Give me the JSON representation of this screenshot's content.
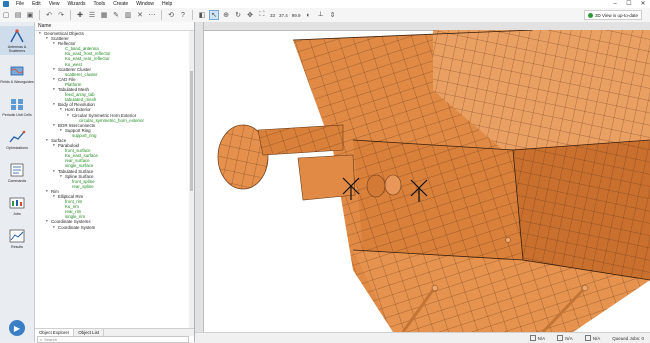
{
  "menubar": {
    "items": [
      "File",
      "Edit",
      "View",
      "Wizards",
      "Tools",
      "Create",
      "Window",
      "Help"
    ]
  },
  "toolbar": {
    "zoom_a": "33",
    "zoom_b": "37.4",
    "zoom_c": "99.9",
    "status_text": "3D View is up-to-date",
    "status_color": "#2e9b3a"
  },
  "sidebar": {
    "items": [
      {
        "label": "Antennas & Scatterers",
        "icon": "antenna-icon"
      },
      {
        "label": "Fields & Waveguides",
        "icon": "waveguide-icon"
      },
      {
        "label": "Periodic Unit Cells",
        "icon": "unit-cell-icon"
      },
      {
        "label": "Optimizations",
        "icon": "optimization-icon"
      },
      {
        "label": "Commands",
        "icon": "commands-icon"
      },
      {
        "label": "Jobs",
        "icon": "jobs-icon"
      },
      {
        "label": "Results",
        "icon": "results-icon"
      }
    ]
  },
  "tree": {
    "header": "Name",
    "search_placeholder": "Search",
    "rows": [
      {
        "label": "Geometrical Objects",
        "level": 0,
        "exp": "▾",
        "green": false
      },
      {
        "label": "Scatterer",
        "level": 1,
        "exp": "▾",
        "green": false
      },
      {
        "label": "Reflector",
        "level": 2,
        "exp": "▾",
        "green": false
      },
      {
        "label": "C_band_antenna",
        "level": 3,
        "exp": "",
        "green": true
      },
      {
        "label": "Ku_east_front_reflector",
        "level": 3,
        "exp": "",
        "green": true
      },
      {
        "label": "Ku_east_rear_reflector",
        "level": 3,
        "exp": "",
        "green": true
      },
      {
        "label": "Ku_west",
        "level": 3,
        "exp": "",
        "green": true
      },
      {
        "label": "Scatterer Cluster",
        "level": 2,
        "exp": "▾",
        "green": false
      },
      {
        "label": "scatterer_cluster",
        "level": 3,
        "exp": "",
        "green": true
      },
      {
        "label": "CAD File",
        "level": 2,
        "exp": "▾",
        "green": false
      },
      {
        "label": "Platform",
        "level": 3,
        "exp": "",
        "green": true
      },
      {
        "label": "Tabulated Mesh",
        "level": 2,
        "exp": "▾",
        "green": false
      },
      {
        "label": "feed_array_tab",
        "level": 3,
        "exp": "",
        "green": true
      },
      {
        "label": "tabulated_mesh",
        "level": 3,
        "exp": "",
        "green": true
      },
      {
        "label": "Body of Revolution",
        "level": 2,
        "exp": "▾",
        "green": false
      },
      {
        "label": "Horn Exterior",
        "level": 3,
        "exp": "▾",
        "green": false
      },
      {
        "label": "Circular Symmetric Horn Exterior",
        "level": 4,
        "exp": "▾",
        "green": false
      },
      {
        "label": "circular_symmetric_horn_exterior",
        "level": 5,
        "exp": "",
        "green": true
      },
      {
        "label": "BOR Interconnects",
        "level": 2,
        "exp": "▾",
        "green": false
      },
      {
        "label": "Support Ring",
        "level": 3,
        "exp": "▾",
        "green": false
      },
      {
        "label": "support_ring",
        "level": 4,
        "exp": "",
        "green": true
      },
      {
        "label": "Surface",
        "level": 1,
        "exp": "▾",
        "green": false
      },
      {
        "label": "Paraboloid",
        "level": 2,
        "exp": "▾",
        "green": false
      },
      {
        "label": "front_surface",
        "level": 3,
        "exp": "",
        "green": true
      },
      {
        "label": "Ku_east_surface",
        "level": 3,
        "exp": "",
        "green": true
      },
      {
        "label": "rear_surface",
        "level": 3,
        "exp": "",
        "green": true
      },
      {
        "label": "single_surface",
        "level": 3,
        "exp": "",
        "green": true
      },
      {
        "label": "Tabulated Surface",
        "level": 2,
        "exp": "▾",
        "green": false
      },
      {
        "label": "Spline Surface",
        "level": 3,
        "exp": "▾",
        "green": false
      },
      {
        "label": "front_spline",
        "level": 4,
        "exp": "",
        "green": true
      },
      {
        "label": "rear_spline",
        "level": 4,
        "exp": "",
        "green": true
      },
      {
        "label": "Rim",
        "level": 1,
        "exp": "▾",
        "green": false
      },
      {
        "label": "Elliptical Rim",
        "level": 2,
        "exp": "▾",
        "green": false
      },
      {
        "label": "front_rim",
        "level": 3,
        "exp": "",
        "green": true
      },
      {
        "label": "Ku_rim",
        "level": 3,
        "exp": "",
        "green": true
      },
      {
        "label": "rear_rim",
        "level": 3,
        "exp": "",
        "green": true
      },
      {
        "label": "single_rim",
        "level": 3,
        "exp": "",
        "green": true
      },
      {
        "label": "Coordinate Systems",
        "level": 1,
        "exp": "▾",
        "green": false
      },
      {
        "label": "Coordinate System",
        "level": 2,
        "exp": "▾",
        "green": false
      }
    ],
    "tabs": [
      {
        "label": "Object Explorer",
        "active": true
      },
      {
        "label": "Object List",
        "active": false
      }
    ]
  },
  "statusbar": {
    "cell_1": "N/A",
    "cell_2": "N/A",
    "cell_3": "N/A",
    "queued_jobs": "Queued Jobs: 0"
  }
}
